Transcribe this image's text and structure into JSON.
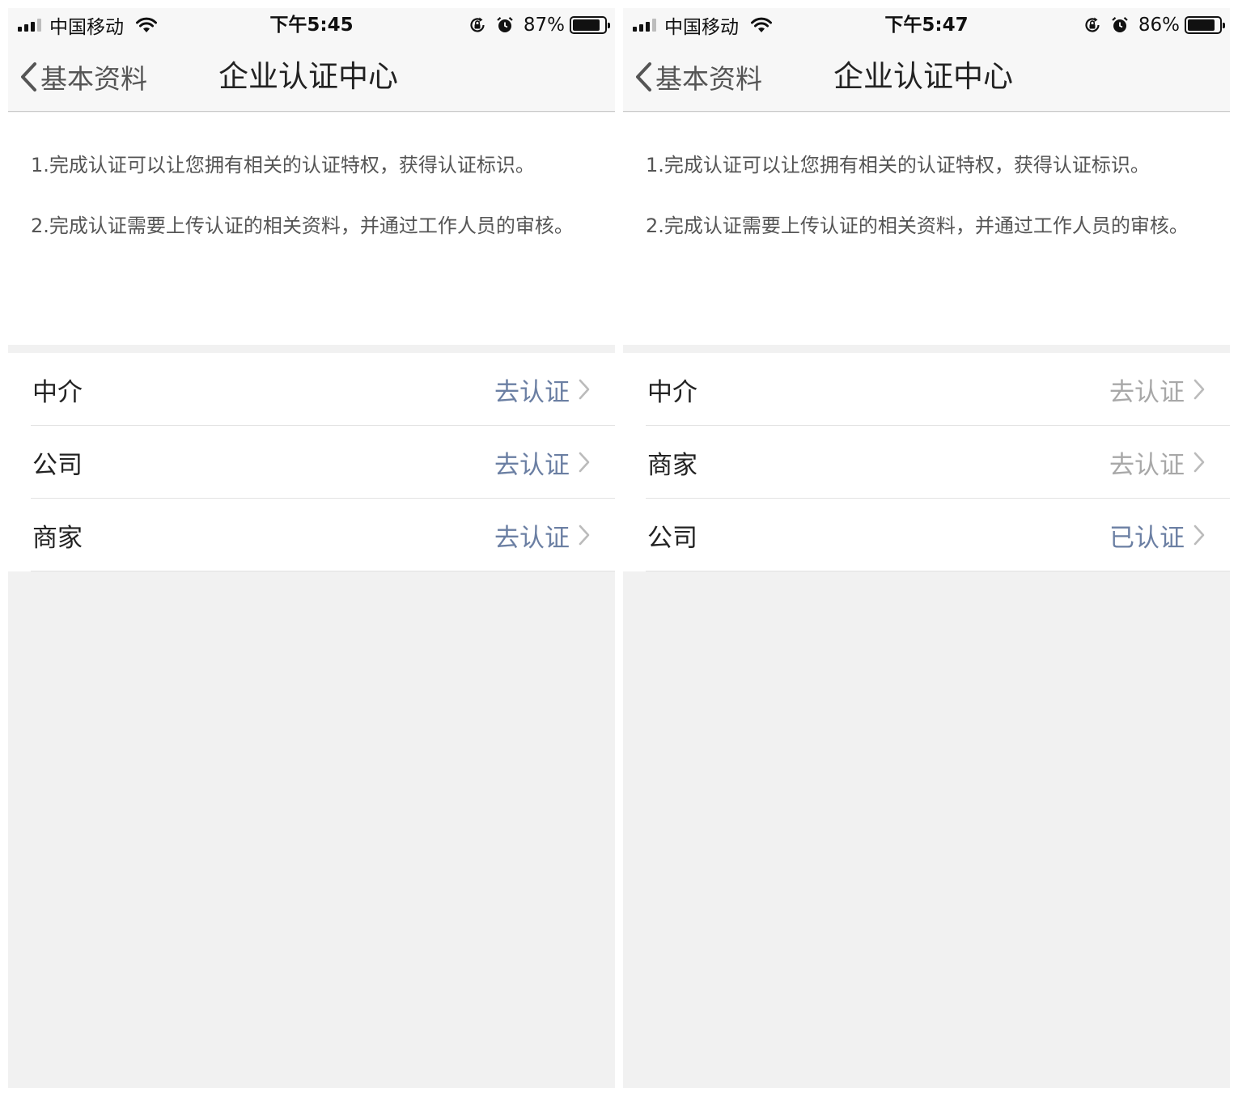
{
  "screens": [
    {
      "status_bar": {
        "carrier": "中国移动",
        "time": "下午5:45",
        "battery_pct": "87%",
        "battery_level": 0.87
      },
      "nav": {
        "back_label": "基本资料",
        "title": "企业认证中心"
      },
      "info": {
        "line1": "1.完成认证可以让您拥有相关的认证特权，获得认证标识。",
        "line2": "2.完成认证需要上传认证的相关资料，并通过工作人员的审核。"
      },
      "items": [
        {
          "label": "中介",
          "status": "去认证",
          "status_color": "#6b7fa3"
        },
        {
          "label": "公司",
          "status": "去认证",
          "status_color": "#6b7fa3"
        },
        {
          "label": "商家",
          "status": "去认证",
          "status_color": "#6b7fa3"
        }
      ]
    },
    {
      "status_bar": {
        "carrier": "中国移动",
        "time": "下午5:47",
        "battery_pct": "86%",
        "battery_level": 0.86
      },
      "nav": {
        "back_label": "基本资料",
        "title": "企业认证中心"
      },
      "info": {
        "line1": "1.完成认证可以让您拥有相关的认证特权，获得认证标识。",
        "line2": "2.完成认证需要上传认证的相关资料，并通过工作人员的审核。"
      },
      "items": [
        {
          "label": "中介",
          "status": "去认证",
          "status_color": "#a8a8a8"
        },
        {
          "label": "商家",
          "status": "去认证",
          "status_color": "#a8a8a8"
        },
        {
          "label": "公司",
          "status": "已认证",
          "status_color": "#6b7fa3"
        }
      ]
    }
  ],
  "icons": {
    "signal": "cellular-signal-icon",
    "wifi": "wifi-icon",
    "rotation_lock": "rotation-lock-icon",
    "alarm": "alarm-icon",
    "battery": "battery-icon",
    "back": "chevron-left-icon",
    "disclosure": "chevron-right-icon"
  }
}
